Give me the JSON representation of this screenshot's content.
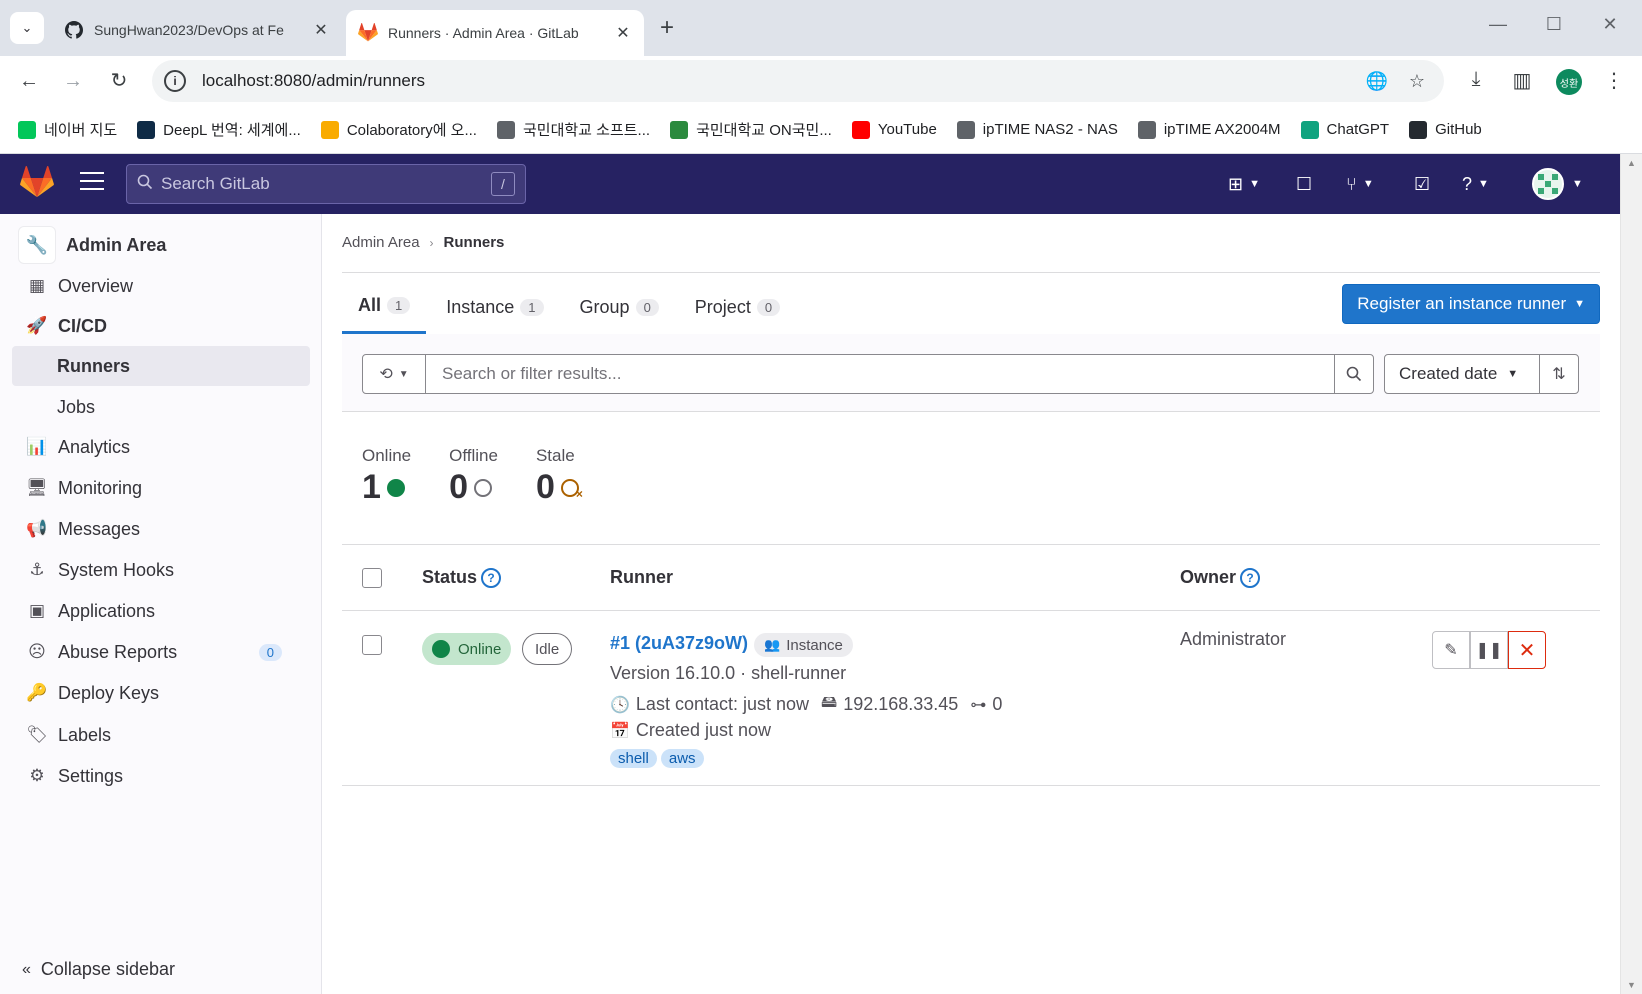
{
  "browser": {
    "tabs": [
      {
        "title": "SungHwan2023/DevOps at Fe",
        "icon": "github-icon"
      },
      {
        "title": "Runners · Admin Area · GitLab",
        "icon": "gitlab-icon"
      }
    ],
    "url": "localhost:8080/admin/runners",
    "profile_initials": "성환",
    "bookmarks": [
      {
        "label": "네이버 지도",
        "color": "#03c75a"
      },
      {
        "label": "DeepL 번역: 세계에...",
        "color": "#0f2b46"
      },
      {
        "label": "Colaboratory에 오...",
        "color": "#f9ab00"
      },
      {
        "label": "국민대학교 소프트...",
        "color": "#5f6368"
      },
      {
        "label": "국민대학교 ON국민...",
        "color": "#2b8a3e"
      },
      {
        "label": "YouTube",
        "color": "#ff0000"
      },
      {
        "label": "ipTIME NAS2 - NAS",
        "color": "#5f6368"
      },
      {
        "label": "ipTIME AX2004M",
        "color": "#5f6368"
      },
      {
        "label": "ChatGPT",
        "color": "#10a37f"
      },
      {
        "label": "GitHub",
        "color": "#24292f"
      }
    ]
  },
  "header": {
    "search_placeholder": "Search GitLab",
    "search_shortcut": "/"
  },
  "sidebar": {
    "title": "Admin Area",
    "items": [
      {
        "label": "Overview",
        "icon": "overview-icon"
      },
      {
        "label": "CI/CD",
        "icon": "rocket-icon"
      },
      {
        "label": "Runners"
      },
      {
        "label": "Jobs"
      },
      {
        "label": "Analytics",
        "icon": "chart-icon"
      },
      {
        "label": "Monitoring",
        "icon": "monitor-icon"
      },
      {
        "label": "Messages",
        "icon": "bullhorn-icon"
      },
      {
        "label": "System Hooks",
        "icon": "anchor-icon"
      },
      {
        "label": "Applications",
        "icon": "apps-icon"
      },
      {
        "label": "Abuse Reports",
        "icon": "abuse-icon",
        "badge": "0"
      },
      {
        "label": "Deploy Keys",
        "icon": "key-icon"
      },
      {
        "label": "Labels",
        "icon": "label-icon"
      },
      {
        "label": "Settings",
        "icon": "settings-icon"
      }
    ],
    "collapse_label": "Collapse sidebar"
  },
  "breadcrumb": {
    "parent": "Admin Area",
    "current": "Runners"
  },
  "tabs": [
    {
      "label": "All",
      "count": "1"
    },
    {
      "label": "Instance",
      "count": "1"
    },
    {
      "label": "Group",
      "count": "0"
    },
    {
      "label": "Project",
      "count": "0"
    }
  ],
  "register_button": "Register an instance runner",
  "filter": {
    "placeholder": "Search or filter results...",
    "sort_label": "Created date"
  },
  "stats": [
    {
      "label": "Online",
      "value": "1"
    },
    {
      "label": "Offline",
      "value": "0"
    },
    {
      "label": "Stale",
      "value": "0"
    }
  ],
  "table": {
    "headers": {
      "status": "Status",
      "runner": "Runner",
      "owner": "Owner"
    },
    "rows": [
      {
        "status": "Online",
        "state": "Idle",
        "name": "#1 (2uA37z9oW)",
        "type": "Instance",
        "version": "Version 16.10.0 · shell-runner",
        "last_contact": "Last contact: just now",
        "ip": "192.168.33.45",
        "jobs": "0",
        "created": "Created just now",
        "tags": [
          "shell",
          "aws"
        ],
        "owner": "Administrator"
      }
    ]
  },
  "colors": {
    "header_bg": "#262262",
    "primary": "#1f75cb",
    "online": "#108548",
    "danger": "#dd2b0e"
  }
}
